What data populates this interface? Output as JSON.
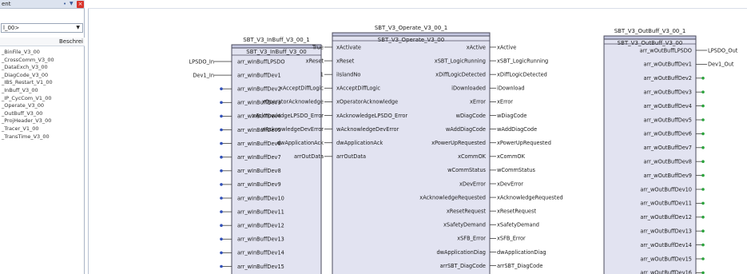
{
  "panel": {
    "title": "ent",
    "library_value": "l_00>",
    "column_header": "Beschrei",
    "items": [
      "_BinFile_V3_00",
      "_CrossComm_V3_00",
      "_DataExch_V3_00",
      "_DiagCode_V3_00",
      "_IBS_Restart_V1_00",
      "_InBuff_V3_00",
      "_IP_CycCom_V1_00",
      "_Operate_V3_00",
      "_OutBuff_V3_00",
      "_ProjHeader_V3_00",
      "_Tracer_V1_00",
      "_TransTime_V3_00"
    ]
  },
  "canvas": {
    "inbuff": {
      "instance": "SBT_V3_InBuff_V3_00_1",
      "type": "SBT_V3_InBuff_V3_00",
      "pins": [
        {
          "label": "arr_wInBuffLPSDO",
          "var": "LPSDO_In"
        },
        {
          "label": "arr_wInBuffDev1",
          "var": "Dev1_In"
        },
        {
          "label": "arr_wInBuffDev2",
          "var": ""
        },
        {
          "label": "arr_wInBuffDev3",
          "var": ""
        },
        {
          "label": "arr_wInBuffDev4",
          "var": ""
        },
        {
          "label": "arr_wInBuffDev5",
          "var": ""
        },
        {
          "label": "arr_wInBuffDev6",
          "var": ""
        },
        {
          "label": "arr_wInBuffDev7",
          "var": ""
        },
        {
          "label": "arr_wInBuffDev8",
          "var": ""
        },
        {
          "label": "arr_wInBuffDev9",
          "var": ""
        },
        {
          "label": "arr_wInBuffDev10",
          "var": ""
        },
        {
          "label": "arr_wInBuffDev11",
          "var": ""
        },
        {
          "label": "arr_wInBuffDev12",
          "var": ""
        },
        {
          "label": "arr_wInBuffDev13",
          "var": ""
        },
        {
          "label": "arr_wInBuffDev14",
          "var": ""
        },
        {
          "label": "arr_wInBuffDev15",
          "var": ""
        }
      ]
    },
    "operate": {
      "instance": "SBT_V3_Operate_V3_00_1",
      "type": "SBT_V3_Operate_V3_00",
      "inputs": [
        {
          "label": "xActivate",
          "var": "True"
        },
        {
          "label": "xReset",
          "var": "xReset"
        },
        {
          "label": "iIslandNo",
          "var": "1"
        },
        {
          "label": "xAcceptDiffLogic",
          "var": "xAcceptDiffLogic"
        },
        {
          "label": "xOperatorAcknowledge",
          "var": "xOperatorAcknowledge"
        },
        {
          "label": "xAcknowledgeLPSDO_Error",
          "var": "xAcknowledgeLPSDO_Error"
        },
        {
          "label": "wAcknowledgeDevError",
          "var": "wAcknowledgeDevError"
        },
        {
          "label": "dwApplicationAck",
          "var": "dwApplicationAck"
        },
        {
          "label": "arrOutData",
          "var": "arrOutData"
        }
      ],
      "outputs": [
        {
          "label": "xActive",
          "var": "xActive"
        },
        {
          "label": "xSBT_LogicRunning",
          "var": "xSBT_LogicRunning"
        },
        {
          "label": "xDiffLogicDetected",
          "var": "xDiffLogicDetected"
        },
        {
          "label": "iDownloaded",
          "var": "iDownload"
        },
        {
          "label": "xError",
          "var": "xError"
        },
        {
          "label": "wDiagCode",
          "var": "wDiagCode"
        },
        {
          "label": "wAddDiagCode",
          "var": "wAddDiagCode"
        },
        {
          "label": "xPowerUpRequested",
          "var": "xPowerUpRequested"
        },
        {
          "label": "xCommOK",
          "var": "xCommOK"
        },
        {
          "label": "wCommStatus",
          "var": "wCommStatus"
        },
        {
          "label": "xDevError",
          "var": "xDevError"
        },
        {
          "label": "xAcknowledgeRequested",
          "var": "xAcknowledgeRequested"
        },
        {
          "label": "xResetRequest",
          "var": "xResetRequest"
        },
        {
          "label": "xSafetyDemand",
          "var": "xSafetyDemand"
        },
        {
          "label": "xSFB_Error",
          "var": "xSFB_Error"
        },
        {
          "label": "dwApplicationDiag",
          "var": "dwApplicationDiag"
        },
        {
          "label": "arrSBT_DiagCode",
          "var": "arrSBT_DiagCode"
        }
      ]
    },
    "outbuff": {
      "instance": "SBT_V3_OutBuff_V3_00_1",
      "type": "SBT_V3_OutBuff_V3_00",
      "pins": [
        {
          "label": "arr_wOutBuffLPSDO",
          "var": "LPSDO_Out"
        },
        {
          "label": "arr_wOutBuffDev1",
          "var": "Dev1_Out"
        },
        {
          "label": "arr_wOutBuffDev2",
          "var": ""
        },
        {
          "label": "arr_wOutBuffDev3",
          "var": ""
        },
        {
          "label": "arr_wOutBuffDev4",
          "var": ""
        },
        {
          "label": "arr_wOutBuffDev5",
          "var": ""
        },
        {
          "label": "arr_wOutBuffDev6",
          "var": ""
        },
        {
          "label": "arr_wOutBuffDev7",
          "var": ""
        },
        {
          "label": "arr_wOutBuffDev8",
          "var": ""
        },
        {
          "label": "arr_wOutBuffDev9",
          "var": ""
        },
        {
          "label": "arr_wOutBuffDev10",
          "var": ""
        },
        {
          "label": "arr_wOutBuffDev11",
          "var": ""
        },
        {
          "label": "arr_wOutBuffDev12",
          "var": ""
        },
        {
          "label": "arr_wOutBuffDev13",
          "var": ""
        },
        {
          "label": "arr_wOutBuffDev14",
          "var": ""
        },
        {
          "label": "arr_wOutBuffDev15",
          "var": ""
        },
        {
          "label": "arr_wOutBuffDev16",
          "var": ""
        }
      ]
    }
  },
  "colors": {
    "block_fill": "#e2e3f1",
    "block_header": "#c4c7e0",
    "block_border": "#4b4b5c",
    "input_dot": "#2f4fb8",
    "output_dot": "#2aa33b",
    "wire": "#3b3b3b"
  }
}
